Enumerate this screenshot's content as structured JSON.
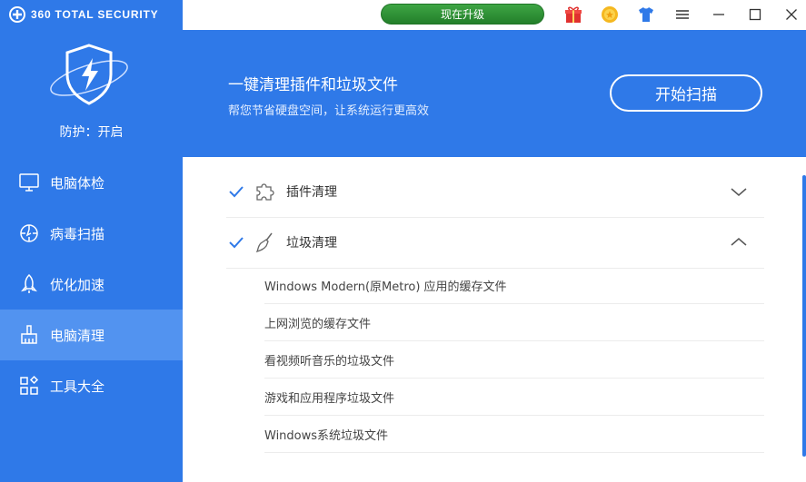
{
  "app": {
    "name": "360 TOTAL SECURITY"
  },
  "sidebar": {
    "protection_status": "防护：开启",
    "items": [
      {
        "label": "电脑体检",
        "icon": "monitor-icon"
      },
      {
        "label": "病毒扫描",
        "icon": "scan-target-icon"
      },
      {
        "label": "优化加速",
        "icon": "rocket-icon"
      },
      {
        "label": "电脑清理",
        "icon": "broom-icon",
        "active": true
      },
      {
        "label": "工具大全",
        "icon": "apps-grid-icon"
      }
    ]
  },
  "titlebar": {
    "upgrade_label": "现在升级",
    "icons": [
      "gift-icon",
      "coin-icon",
      "tshirt-icon",
      "menu-icon",
      "minimize-icon",
      "maximize-icon",
      "close-icon"
    ]
  },
  "banner": {
    "title": "一键清理插件和垃圾文件",
    "subtitle": "帮您节省硬盘空间，让系统运行更高效",
    "scan_button": "开始扫描"
  },
  "sections": [
    {
      "label": "插件清理",
      "checked": true,
      "expanded": false,
      "icon": "puzzle-icon"
    },
    {
      "label": "垃圾清理",
      "checked": true,
      "expanded": true,
      "icon": "broom-icon"
    }
  ],
  "junk_items": [
    "Windows Modern(原Metro) 应用的缓存文件",
    "上网浏览的缓存文件",
    "看视频听音乐的垃圾文件",
    "游戏和应用程序垃圾文件",
    "Windows系统垃圾文件"
  ],
  "colors": {
    "brand_blue": "#2f79e8",
    "active_blue": "#5293f0",
    "upgrade_green": "#2e9637"
  }
}
